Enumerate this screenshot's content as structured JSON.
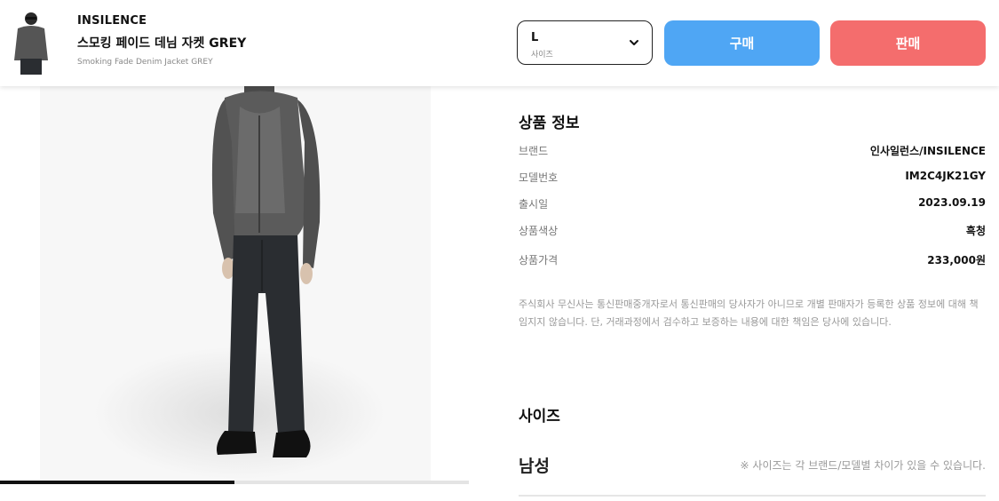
{
  "header": {
    "brand": "INSILENCE",
    "product_name_ko": "스모킹 페이드 데님 자켓 GREY",
    "product_name_en": "Smoking Fade Denim Jacket GREY",
    "size_select": {
      "value": "L",
      "caption": "사이즈"
    },
    "buy_label": "구매",
    "sell_label": "판매"
  },
  "gallery": {
    "progress": 0.5
  },
  "info": {
    "title": "상품 정보",
    "rows": [
      {
        "label": "브랜드",
        "value": "인사일런스/INSILENCE"
      },
      {
        "label": "모델번호",
        "value": "IM2C4JK21GY"
      },
      {
        "label": "출시일",
        "value": "2023.09.19"
      },
      {
        "label": "상품색상",
        "value": "흑청"
      },
      {
        "label": "상품가격",
        "value": "233,000원"
      }
    ],
    "disclaimer": "주식회사 무신사는 통신판매중개자로서 통신판매의 당사자가 아니므로 개별 판매자가 등록한 상품 정보에 대해 책임지지 않습니다. 단, 거래과정에서 검수하고 보증하는 내용에 대한 책임은 당사에 있습니다."
  },
  "size_section": {
    "title": "사이즈",
    "gender": "남성",
    "note": "※ 사이즈는 각 브랜드/모델별 차이가 있을 수 있습니다."
  },
  "colors": {
    "buy": "#4fa6f4",
    "sell": "#f46d6d",
    "jacket": "#5a5a5a",
    "jeans": "#2a2d31"
  }
}
